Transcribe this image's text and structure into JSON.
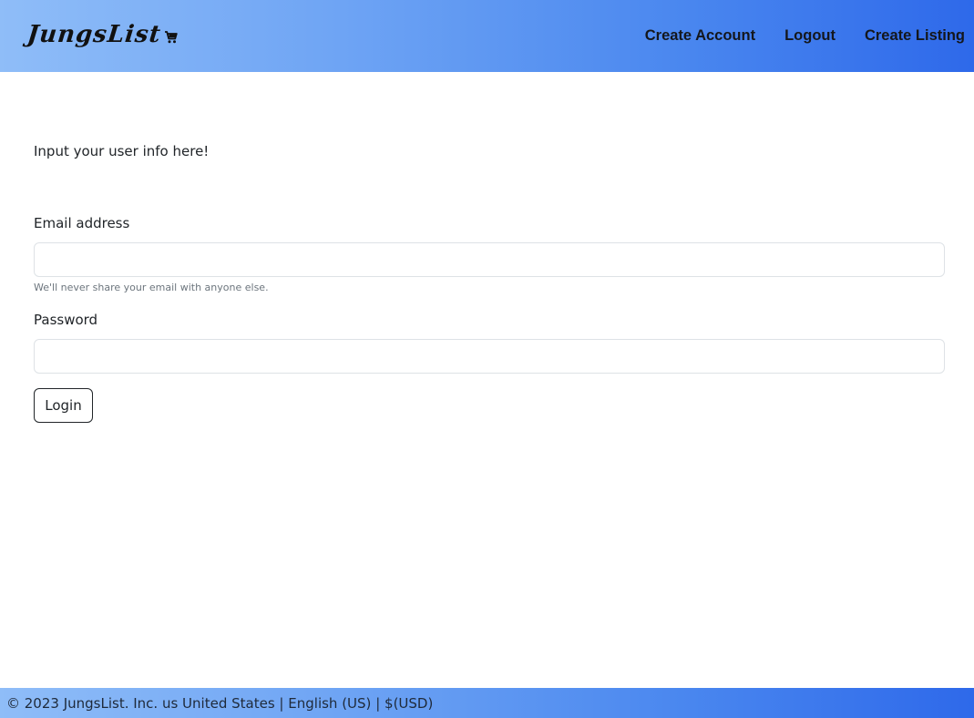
{
  "header": {
    "brand": "JungsList",
    "brand_icon": "cart-icon",
    "nav": {
      "create_account": "Create Account",
      "logout": "Logout",
      "create_listing": "Create Listing"
    }
  },
  "main": {
    "intro": "Input your user info here!",
    "email_label": "Email address",
    "email_value": "",
    "email_help": "We'll never share your email with anyone else.",
    "password_label": "Password",
    "password_value": "",
    "login_button": "Login"
  },
  "footer": {
    "copyright": "© 2023 JungsList. Inc.",
    "region": "us United States",
    "language": "English (US)",
    "currency": "$(USD)",
    "separator": "|"
  },
  "colors": {
    "gradient_start": "#8fbdf8",
    "gradient_end": "#2e69ea"
  }
}
